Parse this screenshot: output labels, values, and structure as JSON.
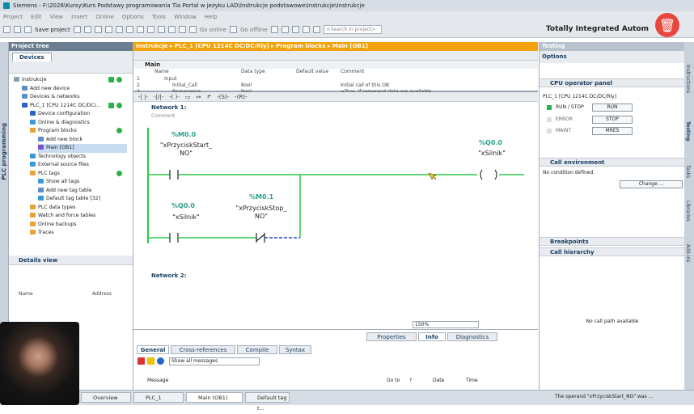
{
  "window": {
    "title": "Siemens  -  F:\\2026\\Kursy\\Kurs Podstawy programowania Tia Portal w jezyku LAD\\Instrukcje podstawowe\\Instrukcje\\Instrukcje",
    "brand": "Totally Integrated Autom"
  },
  "menu": [
    "Project",
    "Edit",
    "View",
    "Insert",
    "Online",
    "Options",
    "Tools",
    "Window",
    "Help"
  ],
  "toolbar": {
    "save": "Save project",
    "go_online": "Go online",
    "go_offline": "Go offline",
    "search_placeholder": "<Search in project>"
  },
  "sidebar_tab": "PLC programming",
  "project_tree": {
    "title": "Project tree",
    "tab": "Devices",
    "items": [
      {
        "label": "Instrukcje",
        "level": 0
      },
      {
        "label": "Add new device",
        "level": 1
      },
      {
        "label": "Devices & networks",
        "level": 1
      },
      {
        "label": "PLC_1 [CPU 1214C DC/DC/...",
        "level": 1
      },
      {
        "label": "Device configuration",
        "level": 2
      },
      {
        "label": "Online & diagnostics",
        "level": 2
      },
      {
        "label": "Program blocks",
        "level": 2
      },
      {
        "label": "Add new block",
        "level": 3
      },
      {
        "label": "Main [OB1]",
        "level": 3
      },
      {
        "label": "Technology objects",
        "level": 2
      },
      {
        "label": "External source files",
        "level": 2
      },
      {
        "label": "PLC tags",
        "level": 2
      },
      {
        "label": "Show all tags",
        "level": 3
      },
      {
        "label": "Add new tag table",
        "level": 3
      },
      {
        "label": "Default tag table [32]",
        "level": 3
      },
      {
        "label": "PLC data types",
        "level": 2
      },
      {
        "label": "Watch and force tables",
        "level": 2
      },
      {
        "label": "Online backups",
        "level": 2
      },
      {
        "label": "Traces",
        "level": 2
      }
    ]
  },
  "details": {
    "title": "Details view",
    "col_name": "Name",
    "col_address": "Address"
  },
  "editor": {
    "breadcrumb": "Instrukcje  ▸  PLC_1 [CPU 1214C DC/DC/Rly]  ▸  Program blocks  ▸  Main [OB1]",
    "block": "Main",
    "columns": {
      "name": "Name",
      "type": "Data type",
      "default": "Default value",
      "comment": "Comment"
    },
    "rows": [
      {
        "num": "1",
        "name": "Input",
        "type": "",
        "comment": ""
      },
      {
        "num": "2",
        "name": "Initial_Call",
        "type": "Bool",
        "comment": "Initial call of this OB"
      },
      {
        "num": "3",
        "name": "Remanence",
        "type": "Bool",
        "comment": "=True, if remanent data are available"
      }
    ],
    "network1": "Network 1:",
    "comment": "Comment",
    "network2": "Network 2:",
    "contacts": [
      {
        "addr": "%M0.0",
        "name": "\"xPrzyciskStart_",
        "name2": "NO\""
      },
      {
        "addr": "%Q0.0",
        "name": "\"xSilnik\"",
        "name2": ""
      },
      {
        "addr": "%M0.1",
        "name": "\"xPrzyciskStop_",
        "name2": "NO\""
      }
    ],
    "coil": {
      "addr": "%Q0.0",
      "name": "\"xSilnik\""
    },
    "zoom": "150%"
  },
  "inspector": {
    "tabs_top": [
      "Properties",
      "Info",
      "Diagnostics"
    ],
    "tabs": [
      "General",
      "Cross-references",
      "Compile",
      "Syntax"
    ],
    "filter": "Show all messages",
    "cols": [
      "Message",
      "Go to",
      "?",
      "Date",
      "Time"
    ]
  },
  "testing": {
    "title": "Testing",
    "options": "Options",
    "cpu_panel": "CPU operator panel",
    "cpu_name": "PLC_1 [CPU 1214C DC/DC/Rly]",
    "modes": [
      {
        "label": "RUN / STOP",
        "btn": "RUN"
      },
      {
        "label": "ERROR",
        "btn": "STOP"
      },
      {
        "label": "MAINT",
        "btn": "MRES"
      }
    ],
    "call_env": "Call environment",
    "no_cond": "No condition defined.",
    "change": "Change ...",
    "breakpoints": "Breakpoints",
    "call_hier": "Call hierarchy",
    "no_call": "No call path available"
  },
  "right_tabs": [
    "Instructions",
    "Testing",
    "Tasks",
    "Libraries",
    "Add-ins"
  ],
  "taskbar": {
    "items": [
      "Overview",
      "PLC_1",
      "Main (OB1)",
      "Default tag t..."
    ],
    "status": "The operand \"xPrzyciskStart_NO\" was ..."
  }
}
